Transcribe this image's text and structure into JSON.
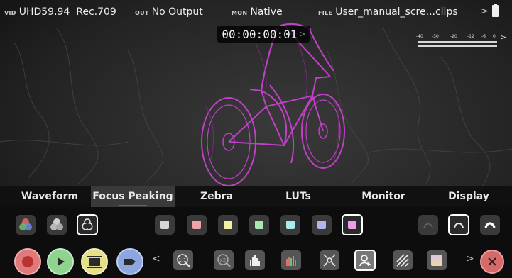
{
  "status_bar": {
    "vid_tag": "VID",
    "vid_value": "UHD59.94  Rec.709",
    "out_tag": "OUT",
    "out_value": "No Output",
    "mon_tag": "MON",
    "mon_value": "Native",
    "file_tag": "FILE",
    "file_value": "User_manual_scre...clips",
    "file_chevron": ">"
  },
  "timecode": {
    "value": "00:00:00:01",
    "chevron": ">"
  },
  "audio_meter": {
    "scale": [
      "-40",
      "-30",
      "-20",
      "-12",
      "-6",
      "0"
    ],
    "chevron": ">"
  },
  "tabs": [
    {
      "label": "Waveform"
    },
    {
      "label": "Focus Peaking"
    },
    {
      "label": "Zebra"
    },
    {
      "label": "LUTs"
    },
    {
      "label": "Monitor"
    },
    {
      "label": "Display"
    }
  ],
  "active_tab": "Focus Peaking",
  "peaking_modes": [
    "color-mode-icon",
    "mono-mode-icon",
    "outline-mode-icon"
  ],
  "peaking_colors": [
    {
      "name": "white",
      "hex": "#d6d6d6"
    },
    {
      "name": "red",
      "hex": "#f2a4a4"
    },
    {
      "name": "yellow",
      "hex": "#f4f0a6"
    },
    {
      "name": "green",
      "hex": "#a6e8b4"
    },
    {
      "name": "cyan",
      "hex": "#a8ecec"
    },
    {
      "name": "blue",
      "hex": "#b0b6f2"
    },
    {
      "name": "magenta",
      "hex": "#ee9ce8"
    }
  ],
  "selected_color": "magenta",
  "sensitivity_levels": [
    "low-sensitivity-icon",
    "mid-sensitivity-icon",
    "high-sensitivity-icon"
  ],
  "selected_sensitivity": "mid-sensitivity-icon",
  "transport": {
    "record_color": "#e07a7a",
    "play_color": "#8ed48e",
    "stop_color": "#e6e08a",
    "tag_color": "#8ea6e0",
    "left_chevron": "<",
    "right_chevron": ">"
  },
  "tools": [
    "zoom-1to1-icon",
    "zoom-2x-icon",
    "histogram-icon",
    "rgb-parade-icon",
    "focus-peaking-tool-icon",
    "peaking-view-icon",
    "zebra-tool-icon",
    "lut-tool-icon"
  ],
  "accent": "#d33333"
}
